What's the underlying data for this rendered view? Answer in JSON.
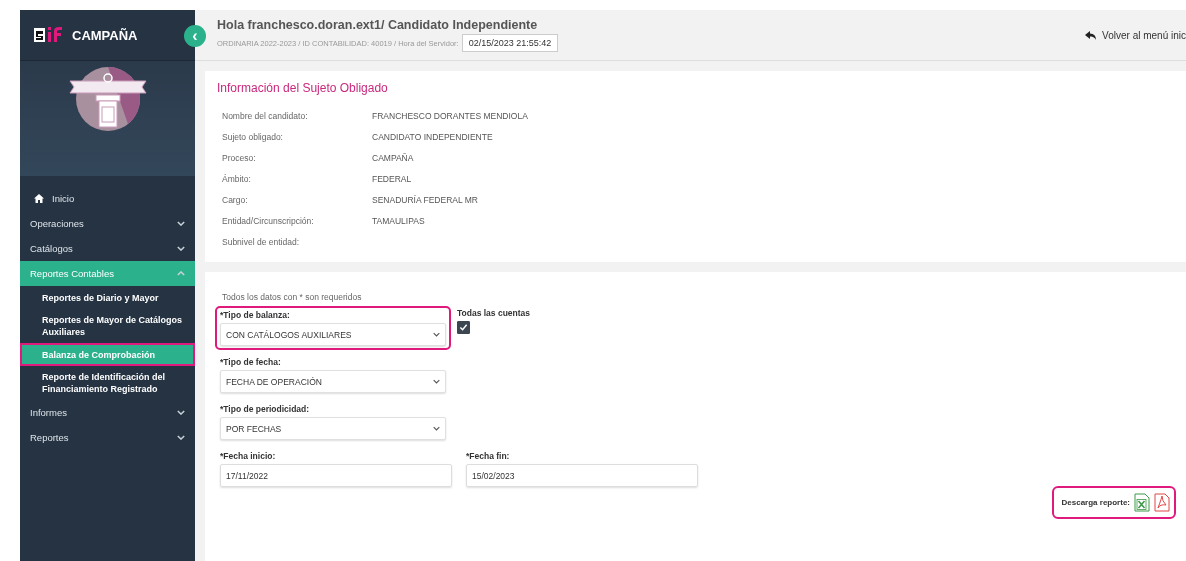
{
  "sidebar": {
    "logo_text": "CAMPAÑA",
    "collapse_icon": "‹",
    "items": [
      {
        "label": "Inicio",
        "kind": "home",
        "selected": false
      },
      {
        "label": "Operaciones",
        "kind": "section",
        "expanded": false,
        "selected": false
      },
      {
        "label": "Catálogos",
        "kind": "section",
        "expanded": false,
        "selected": false
      },
      {
        "label": "Reportes Contables",
        "kind": "section",
        "expanded": true,
        "selected": true,
        "children": [
          {
            "label": "Reportes de Diario y Mayor",
            "selected": false,
            "highlighted": false
          },
          {
            "label": "Reportes de Mayor de Catálogos Auxiliares",
            "selected": false,
            "highlighted": false
          },
          {
            "label": "Balanza de Comprobación",
            "selected": true,
            "highlighted": true
          },
          {
            "label": "Reporte de Identificación del Financiamiento Registrado",
            "selected": false,
            "highlighted": false
          }
        ]
      },
      {
        "label": "Informes",
        "kind": "section",
        "expanded": false,
        "selected": false
      },
      {
        "label": "Reportes",
        "kind": "section",
        "expanded": false,
        "selected": false
      }
    ]
  },
  "header": {
    "greeting": "Hola franchesco.doran.ext1/ Candidato Independiente",
    "subtitle": "ORDINARIA 2022-2023 / ID CONTABILIDAD: 40019 / Hora del Servidor:",
    "server_time": "02/15/2023 21:55:42",
    "back_link": "Volver al menú inic"
  },
  "info": {
    "title": "Información del Sujeto Obligado",
    "rows": [
      {
        "label": "Nombre del candidato:",
        "value": "FRANCHESCO DORANTES MENDIOLA"
      },
      {
        "label": "Sujeto obligado:",
        "value": "CANDIDATO INDEPENDIENTE"
      },
      {
        "label": "Proceso:",
        "value": "CAMPAÑA"
      },
      {
        "label": "Ámbito:",
        "value": "FEDERAL"
      },
      {
        "label": "Cargo:",
        "value": "SENADURÍA FEDERAL MR"
      },
      {
        "label": "Entidad/Circunscripción:",
        "value": "TAMAULIPAS"
      },
      {
        "label": "Subnivel de entidad:"
      }
    ]
  },
  "form": {
    "note": "Todos los datos con * son requeridos",
    "balance_type": {
      "label": "*Tipo de balanza:",
      "value": "CON CATÁLOGOS AUXILIARES",
      "highlighted": true
    },
    "all_accounts": {
      "label": "Todas las cuentas",
      "checked": true
    },
    "date_type": {
      "label": "*Tipo de fecha:",
      "value": "FECHA DE OPERACIÓN",
      "highlighted": false
    },
    "periodicity": {
      "label": "*Tipo de periodicidad:",
      "value": "POR FECHAS",
      "highlighted": false
    },
    "start_date": {
      "label": "*Fecha inicio:",
      "value": "17/11/2022"
    },
    "end_date": {
      "label": "*Fecha fin:",
      "value": "15/02/2023"
    }
  },
  "download": {
    "label": "Descarga reporte:",
    "highlighted": true
  }
}
